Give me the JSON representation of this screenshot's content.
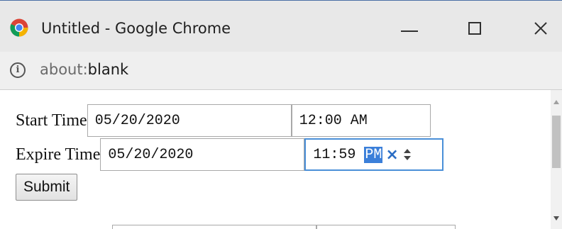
{
  "window": {
    "title": "Untitled - Google Chrome",
    "controls": {
      "minimize": "minimize",
      "maximize": "maximize",
      "close": "close"
    }
  },
  "addressbar": {
    "scheme": "about:",
    "host": "blank",
    "icon": "info-icon"
  },
  "form": {
    "start": {
      "label": "Start Time",
      "date": "05/20/2020",
      "time_hm": "12:00",
      "time_ampm": "AM"
    },
    "expire": {
      "label": "Expire Time",
      "date": "05/20/2020",
      "time_hm": "11:59",
      "time_ampm": "PM",
      "clear_glyph": "×"
    },
    "submit_label": "Submit"
  },
  "colors": {
    "focus_border": "#4a8fd8",
    "selection": "#3b7fd9",
    "titlebar": "#e8e8e8"
  }
}
